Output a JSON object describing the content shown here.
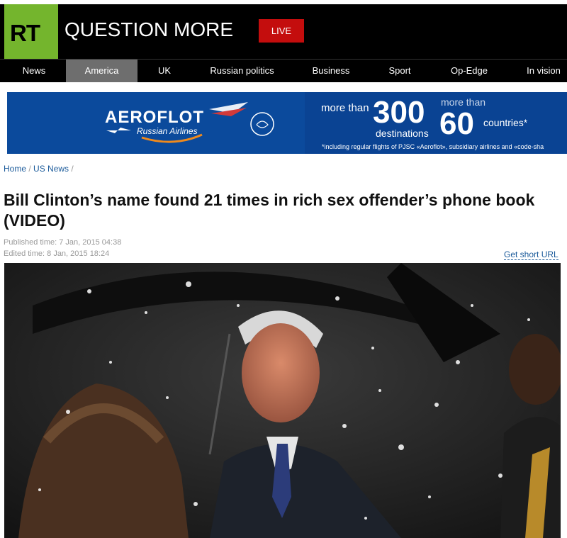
{
  "header": {
    "logo_text": "RT",
    "tagline": "QUESTION MORE",
    "live_label": "LIVE",
    "colors": {
      "logo_green": "#74b52d",
      "live_red": "#c40d0d"
    }
  },
  "nav": {
    "items": [
      "News",
      "America",
      "UK",
      "Russian politics",
      "Business",
      "Sport",
      "Op-Edge",
      "In vision"
    ],
    "active": "America"
  },
  "banner": {
    "brand": "AEROFLOT",
    "subtitle": "Russian Airlines",
    "more_than_1": "more than",
    "number_1": "300",
    "destinations": "destinations",
    "more_than_2": "more than",
    "number_2": "60",
    "countries": "countries*",
    "fineprint": "*including regular flights of PJSC «Aeroflot», subsidiary airlines and «code-sha"
  },
  "breadcrumb": {
    "home": "Home",
    "section": "US News",
    "sep": "/"
  },
  "article": {
    "headline": "Bill Clinton’s name found 21 times in rich sex offender’s phone book (VIDEO)",
    "published": "Published time: 7 Jan, 2015 04:38",
    "edited": "Edited time: 8 Jan, 2015 18:24",
    "short_url": "Get short URL"
  }
}
